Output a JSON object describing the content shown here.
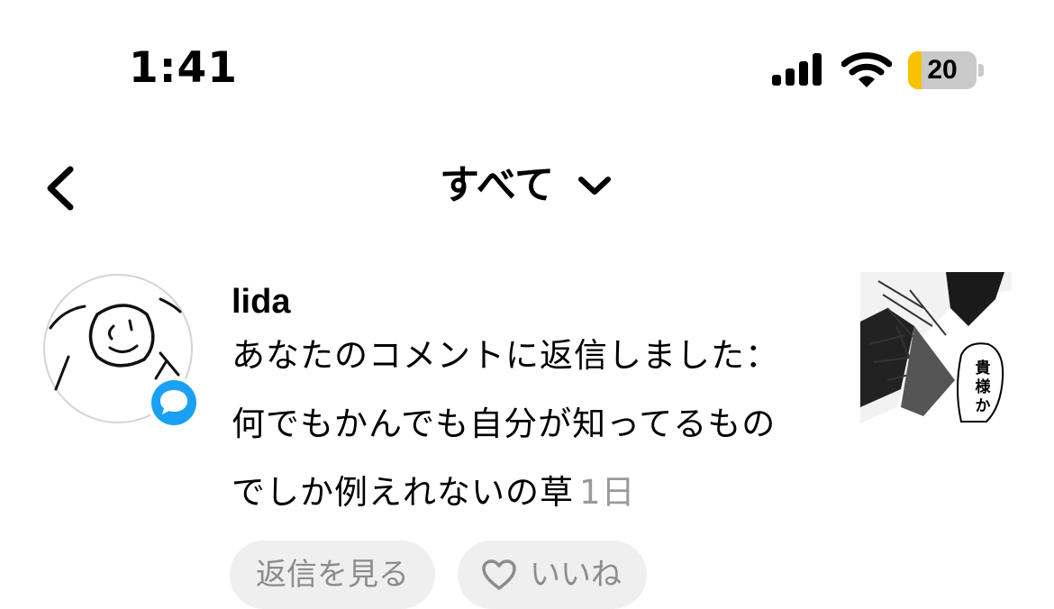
{
  "status_bar": {
    "time": "1:41",
    "battery_percent": "20",
    "battery_level": 0.2,
    "battery_color": "#f8c200"
  },
  "header": {
    "title": "すべて",
    "back_icon": "chevron-left-icon",
    "dropdown_icon": "chevron-down-icon"
  },
  "notification": {
    "username": "lida",
    "message": "あなたのコメントに返信しました：何でもかんでも自分が知ってるものでしか例えれないの草",
    "timestamp": "1日",
    "badge_icon": "comment-bubble-icon",
    "badge_color": "#1aa1f5",
    "thumbnail_text": "貴様か",
    "actions": {
      "view_replies": "返信を見る",
      "like": "いいね"
    }
  }
}
